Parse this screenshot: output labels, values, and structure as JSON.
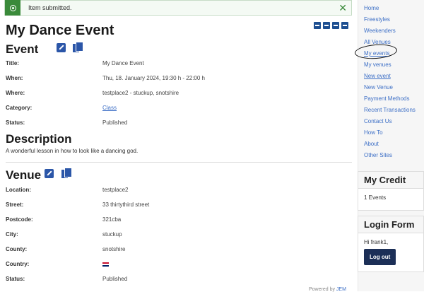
{
  "alert": {
    "message": "Item submitted.",
    "close": "✕"
  },
  "page": {
    "title": "My Dance Event",
    "event_heading": "Event",
    "description_heading": "Description",
    "description": "A wonderful lesson in how to look like a dancing god.",
    "venue_heading": "Venue",
    "powered_prefix": "Powered by ",
    "powered_link": "JEM"
  },
  "event": {
    "rows": [
      {
        "label": "Title:",
        "value": "My Dance Event"
      },
      {
        "label": "When:",
        "value": "Thu, 18. January 2024, 19:30 h - 22:00 h"
      },
      {
        "label": "Where:",
        "value": "testplace2 - stuckup, snotshire"
      },
      {
        "label": "Category:",
        "value": "Class"
      },
      {
        "label": "Status:",
        "value": "Published"
      }
    ]
  },
  "venue": {
    "rows": [
      {
        "label": "Location:",
        "value": "testplace2"
      },
      {
        "label": "Street:",
        "value": "33 thirtythird street"
      },
      {
        "label": "Postcode:",
        "value": "321cba"
      },
      {
        "label": "City:",
        "value": "stuckup"
      },
      {
        "label": "County:",
        "value": "snotshire"
      },
      {
        "label": "Country:",
        "value": ""
      },
      {
        "label": "Status:",
        "value": "Published"
      }
    ]
  },
  "sidebar": {
    "menu": [
      "Home",
      "Freestyles",
      "Weekenders",
      "All Venues",
      "My events",
      "My venues",
      "New event",
      "New Venue",
      "Payment Methods",
      "Recent Transactions",
      "Contact Us",
      "How To",
      "About",
      "Other Sites"
    ],
    "credit_title": "My Credit",
    "credit_value": "1 Events",
    "login_title": "Login Form",
    "greeting": "Hi frank1,",
    "logout_label": "Log out"
  },
  "colors": {
    "accent": "#2b56a8",
    "success": "#3a8a3a",
    "button": "#1c2f57"
  },
  "icons": [
    "check-circle-icon",
    "close-icon",
    "add-event-icon",
    "add-icon",
    "print-icon",
    "calendar-icon",
    "edit-icon",
    "copy-icon",
    "flag-uk-icon"
  ]
}
